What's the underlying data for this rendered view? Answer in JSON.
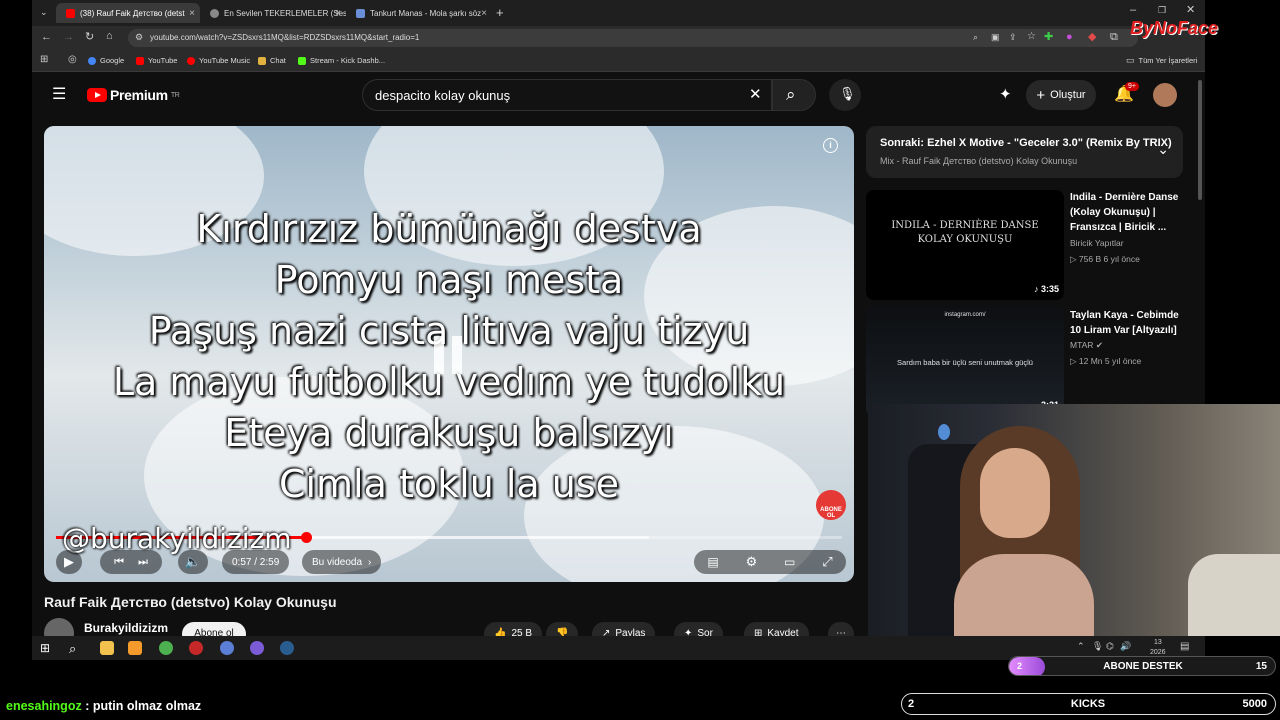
{
  "browser": {
    "tabs": [
      {
        "title": "(38) Rauf Faik Детство (detst"
      },
      {
        "title": "En Sevilen TEKERLEMELER (Ses"
      },
      {
        "title": "Tankurt Manas - Mola şarkı söz"
      }
    ],
    "url": "youtube.com/watch?v=ZSDsxrs11MQ&list=RDZSDsxrs11MQ&start_radio=1",
    "bookmarks": [
      "Google",
      "YouTube",
      "YouTube Music",
      "Chat",
      "Stream - Kick Dashb..."
    ],
    "all_bookmarks_label": "Tüm Yer İşaretleri"
  },
  "youtube": {
    "logo_text": "Premium",
    "logo_sup": "TR",
    "search_value": "despacito kolay okunuş",
    "create_label": "Oluştur",
    "notif_badge": "9+"
  },
  "player": {
    "lyrics": [
      "Kırdırızız bümünağı destva",
      "Pomyu naşı mesta",
      "Paşuş nazi cısta litıva vaju tizyu",
      "La mayu futbolku vedım ye tudolku",
      "Eteya durakuşu balsızyı",
      "Cimla toklu la use"
    ],
    "watermark": "@burakyildizizm",
    "subscribe_watermark": "ABONE OL",
    "current_time": "0:57",
    "duration": "2:59",
    "time_display": "0:57 / 2:59",
    "progress": 0.318,
    "buffered": 0.755,
    "in_video_label": "Bu videoda"
  },
  "video": {
    "title": "Rauf Faik Детство (detstvo) Kolay Okunuşu",
    "channel": "Burakyildizizm",
    "subscribe_label": "Abone ol",
    "likes": "25 B",
    "share_label": "Paylaş",
    "ask_label": "Sor",
    "save_label": "Kaydet"
  },
  "sidebar": {
    "up_next_title": "Sonraki: Ezhel X Motive - \"Geceler 3.0\" (Remix By TRIX)",
    "up_next_sub": "Mix - Rauf Faik Детство (detstvo) Kolay Okunuşu",
    "recommendations": [
      {
        "title": "Indila - Dernière Danse (Kolay Okunuşu) | Fransızca | Biricik ...",
        "channel": "Biricik Yapıtlar",
        "meta": "756 B  6 yıl önce",
        "duration": "3:35",
        "thumb_line1": "INDILA - DERNIÈRE DANSE",
        "thumb_line2": "KOLAY OKUNUŞU"
      },
      {
        "title": "Taylan Kaya - Cebimde 10 Liram Var [Altyazılı]",
        "channel": "MTAR",
        "meta": "12 Mn  5 yıl önce",
        "duration": "3:21",
        "thumb_line1": "instagram.com/",
        "thumb_line2": "Sardım baba bir üçlü seni unutmak güçlü"
      }
    ]
  },
  "taskbar": {
    "date": "13",
    "year": "2026"
  },
  "overlay": {
    "brand": "ByNoFace",
    "chat_user": "enesahingoz",
    "chat_message": " : putin olmaz olmaz",
    "goal_left": "2",
    "goal_label": "ABONE DESTEK",
    "goal_right": "15",
    "goal_fraction": 0.133,
    "kicks_left": "2",
    "kicks_label": "KICKS",
    "kicks_right": "5000"
  },
  "colors": {
    "youtube_red": "#ff0000",
    "kick_green": "#53fc18",
    "goal_purple": "#c86cf0"
  }
}
